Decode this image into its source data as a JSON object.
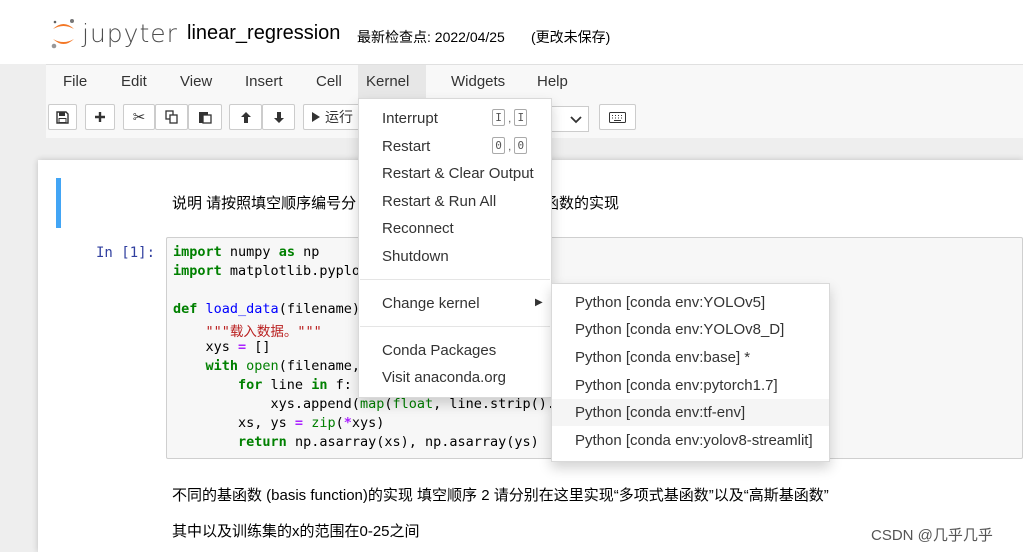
{
  "header": {
    "logo_text": "jupyter",
    "notebook_name": "linear_regression",
    "checkpoint": "最新检查点: 2022/04/25",
    "autosave": "(更改未保存)"
  },
  "menubar": [
    "File",
    "Edit",
    "View",
    "Insert",
    "Cell",
    "Kernel",
    "Widgets",
    "Help"
  ],
  "toolbar": {
    "run_label": "运行",
    "icons": [
      "save-icon",
      "plus-icon",
      "cut-icon",
      "copy-icon",
      "paste-icon",
      "arrow-up-icon",
      "arrow-down-icon",
      "run-icon",
      "keyboard-icon"
    ]
  },
  "kernel_menu": {
    "items": [
      {
        "label": "Interrupt",
        "keys": [
          "I",
          "I"
        ]
      },
      {
        "label": "Restart",
        "keys": [
          "0",
          "0"
        ]
      },
      {
        "label": "Restart & Clear Output"
      },
      {
        "label": "Restart & Run All"
      },
      {
        "label": "Reconnect"
      },
      {
        "label": "Shutdown"
      }
    ],
    "change_kernel": "Change kernel",
    "extras": [
      "Conda Packages",
      "Visit anaconda.org"
    ],
    "kernels": [
      "Python [conda env:YOLOv5]",
      "Python [conda env:YOLOv8_D]",
      "Python [conda env:base] *",
      "Python [conda env:pytorch1.7]",
      "Python [conda env:tf-env]",
      "Python [conda env:yolov8-streamlit]"
    ],
    "hovered_kernel": "Python [conda env:tf-env]"
  },
  "cells": {
    "md1": "说明 请按照填空顺序编号分",
    "md1_tail": "函数的实现",
    "prompt": "In  [1]:",
    "code": [
      "import numpy as np",
      "import matplotlib.pyplo",
      "",
      "def load_data(filename)",
      "    \"\"\"载入数据。\"\"\"",
      "    xys = []",
      "    with open(filename,",
      "        for line in f:",
      "            xys.append(map(float, line.strip().s",
      "        xs, ys = zip(*xys)",
      "        return np.asarray(xs), np.asarray(ys)"
    ],
    "md2": "不同的基函数 (basis function)的实现 填空顺序 2 请分别在这里实现“多项式基函数”以及“高斯基函数”",
    "md3": "其中以及训练集的x的范围在0-25之间"
  },
  "watermark": "CSDN @几乎几乎"
}
